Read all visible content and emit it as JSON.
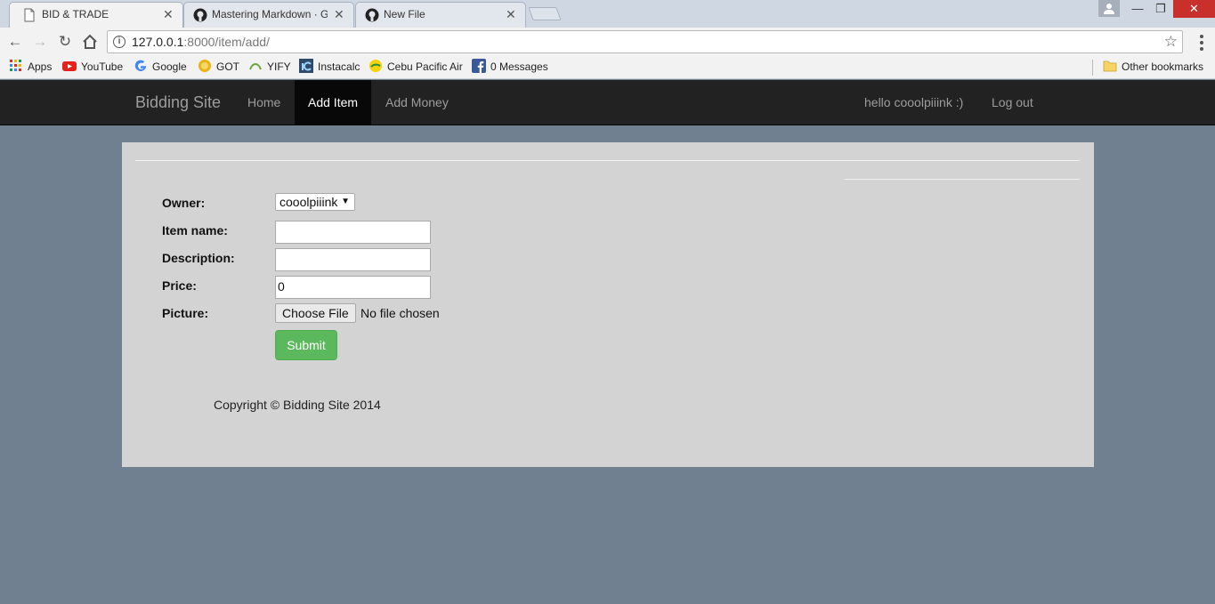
{
  "browser": {
    "tabs": [
      {
        "title": "BID & TRADE",
        "icon": "document-icon",
        "active": true
      },
      {
        "title": "Mastering Markdown · G",
        "icon": "github-icon",
        "active": false
      },
      {
        "title": "New File",
        "icon": "github-icon",
        "active": false
      }
    ],
    "tab_close": "✕",
    "url_host": "127.0.0.1",
    "url_path": ":8000/item/add/",
    "bookmarks": [
      {
        "label": "Apps",
        "icon": "apps-grid-icon"
      },
      {
        "label": "YouTube",
        "icon": "youtube-icon"
      },
      {
        "label": "Google",
        "icon": "google-icon"
      },
      {
        "label": "GOT",
        "icon": "got-icon"
      },
      {
        "label": "YIFY",
        "icon": "yify-icon"
      },
      {
        "label": "Instacalc",
        "icon": "instacalc-icon"
      },
      {
        "label": "Cebu Pacific Air",
        "icon": "cebu-pacific-icon"
      },
      {
        "label": "0 Messages",
        "icon": "facebook-icon"
      }
    ],
    "other_bookmarks": "Other bookmarks"
  },
  "site": {
    "brand": "Bidding Site",
    "nav": {
      "home": "Home",
      "add_item": "Add Item",
      "add_money": "Add Money",
      "greeting": "hello cooolpiiink :)",
      "logout": "Log out"
    }
  },
  "form": {
    "owner_label": "Owner:",
    "owner_value": "cooolpiiink",
    "item_name_label": "Item name:",
    "item_name_value": "",
    "description_label": "Description:",
    "description_value": "",
    "price_label": "Price:",
    "price_value": "0",
    "picture_label": "Picture:",
    "choose_file": "Choose File",
    "file_status": "No file chosen",
    "submit": "Submit"
  },
  "footer": {
    "copyright": "Copyright © Bidding Site 2014"
  },
  "colors": {
    "page_bg": "#708090",
    "panel_bg": "#d3d3d3",
    "navbar_bg": "#222222",
    "submit_green": "#5cb85c"
  }
}
